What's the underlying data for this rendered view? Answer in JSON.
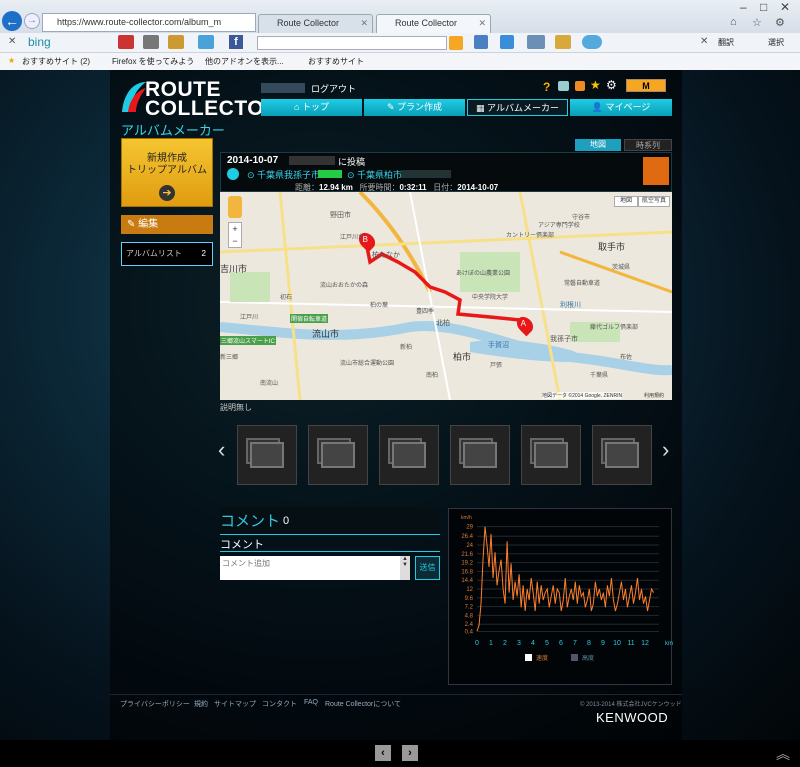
{
  "browser": {
    "url": "https://www.route-collector.com/album_m",
    "tabs": [
      {
        "label": "Route Collector",
        "active": false
      },
      {
        "label": "Route Collector",
        "active": true
      }
    ],
    "bing": "bing",
    "favorites": [
      "おすすめサイト (2)",
      "Firefox を使ってみよう",
      "他のアドオンを表示...",
      "おすすめサイト"
    ],
    "toolbar_right": [
      "翻訳",
      "選択"
    ]
  },
  "header": {
    "logo_line1": "ROUTE",
    "logo_line2": "COLLECTOR",
    "logout": "ログアウト",
    "nav": [
      {
        "label": "トップ",
        "active": false
      },
      {
        "label": "プラン作成",
        "active": false
      },
      {
        "label": "アルバムメーカー",
        "active": true
      },
      {
        "label": "マイページ",
        "active": false
      }
    ]
  },
  "sidebar": {
    "section_title": "アルバムメーカー",
    "new_line1": "新規作成",
    "new_line2": "トリップアルバム",
    "new_arrow": "➔",
    "edit_label": "編集",
    "album_list_label": "アルバムリスト",
    "album_list_count": "2"
  },
  "view_tabs": {
    "map": "地図",
    "timeline": "時系列"
  },
  "post": {
    "date": "2014-10-07",
    "posted": "に投稿",
    "from": "千葉県我孫子市",
    "to": "千葉県柏市",
    "distance_label": "距離：",
    "distance": "12.94 km",
    "duration_label": "所要時間：",
    "duration": "0:32:11",
    "date_label": "日付：",
    "date_value": "2014-10-07"
  },
  "map": {
    "btn_map": "地図",
    "btn_satellite": "航空写真",
    "copyright": "地図データ ©2014 Google, ZENRIN",
    "terms": "利用規約",
    "marker_a": "A",
    "marker_b": "B",
    "labels": [
      "吉川市",
      "流山市",
      "柏市",
      "取手市",
      "我孫子市",
      "北柏",
      "柏たなか",
      "藤代ゴルフ倶楽部",
      "アジア専門学校",
      "カントリー倶楽部",
      "中央学院大学",
      "手賀沼",
      "関宿自転車道",
      "三郷流山スマートIC",
      "流山市総合運動公園",
      "野田市",
      "利根川",
      "新三郷",
      "江戸川台",
      "流山おおたかの森",
      "あけぼの山農業公園",
      "戸張",
      "布佐",
      "新柏",
      "柏の葉",
      "南柏",
      "豊四季",
      "初石",
      "南流山",
      "江戸川",
      "千葉県",
      "茨城県",
      "守谷市",
      "常磐自動車道"
    ],
    "description": "説明無し"
  },
  "gallery": {
    "prev": "‹",
    "next": "›",
    "count": 6
  },
  "comments": {
    "title": "コメント",
    "count": "0",
    "label": "コメント",
    "placeholder": "コメント追加",
    "submit": "送信"
  },
  "colors": {
    "accent": "#1ecde4",
    "route": "#e8171a",
    "speed": "#ff7f2a",
    "nav_gold": "#f5c531"
  },
  "chart_data": {
    "type": "line",
    "title": "",
    "ylabel": "km/h",
    "xlabel": "km",
    "y_ticks": [
      "29",
      "26.4",
      "24",
      "21.6",
      "19.2",
      "16.8",
      "14.4",
      "12",
      "9.6",
      "7.2",
      "4.8",
      "2.4",
      "0.4"
    ],
    "x_ticks": [
      "0",
      "1",
      "2",
      "3",
      "4",
      "5",
      "6",
      "7",
      "8",
      "9",
      "10",
      "11",
      "12"
    ],
    "xlim": [
      0,
      13
    ],
    "ylim": [
      0,
      30
    ],
    "series": [
      {
        "name": "速度",
        "checked": true,
        "values": [
          0.5,
          2,
          8,
          20,
          29,
          24,
          18,
          27,
          15,
          22,
          13,
          17,
          20,
          12,
          8,
          25,
          11,
          19,
          9,
          14,
          10,
          16,
          7,
          13,
          6,
          12,
          9,
          15,
          11,
          6,
          14,
          8,
          13,
          9,
          11,
          12,
          7,
          10,
          13,
          8,
          12,
          11,
          6,
          9,
          15,
          7,
          10,
          12,
          9,
          14,
          8,
          13,
          10,
          11,
          7,
          9,
          12,
          6,
          8,
          14,
          10,
          12,
          9,
          11,
          7,
          13,
          10,
          15,
          9,
          6,
          8,
          11,
          14,
          9,
          12,
          7,
          10,
          13,
          8,
          11,
          15,
          9,
          12,
          8,
          10,
          6,
          9,
          12,
          11
        ]
      },
      {
        "name": "高度",
        "checked": false,
        "values": []
      }
    ]
  },
  "footer": {
    "links": [
      "プライバシーポリシー",
      "規約",
      "サイトマップ",
      "コンタクト",
      "FAQ",
      "Route Collectorについて"
    ],
    "copyright": "© 2013-2014 株式会社JVCケンウッド",
    "brand": "KENWOOD"
  },
  "pager": {
    "prev": "‹",
    "next": "›",
    "top": "︽"
  }
}
